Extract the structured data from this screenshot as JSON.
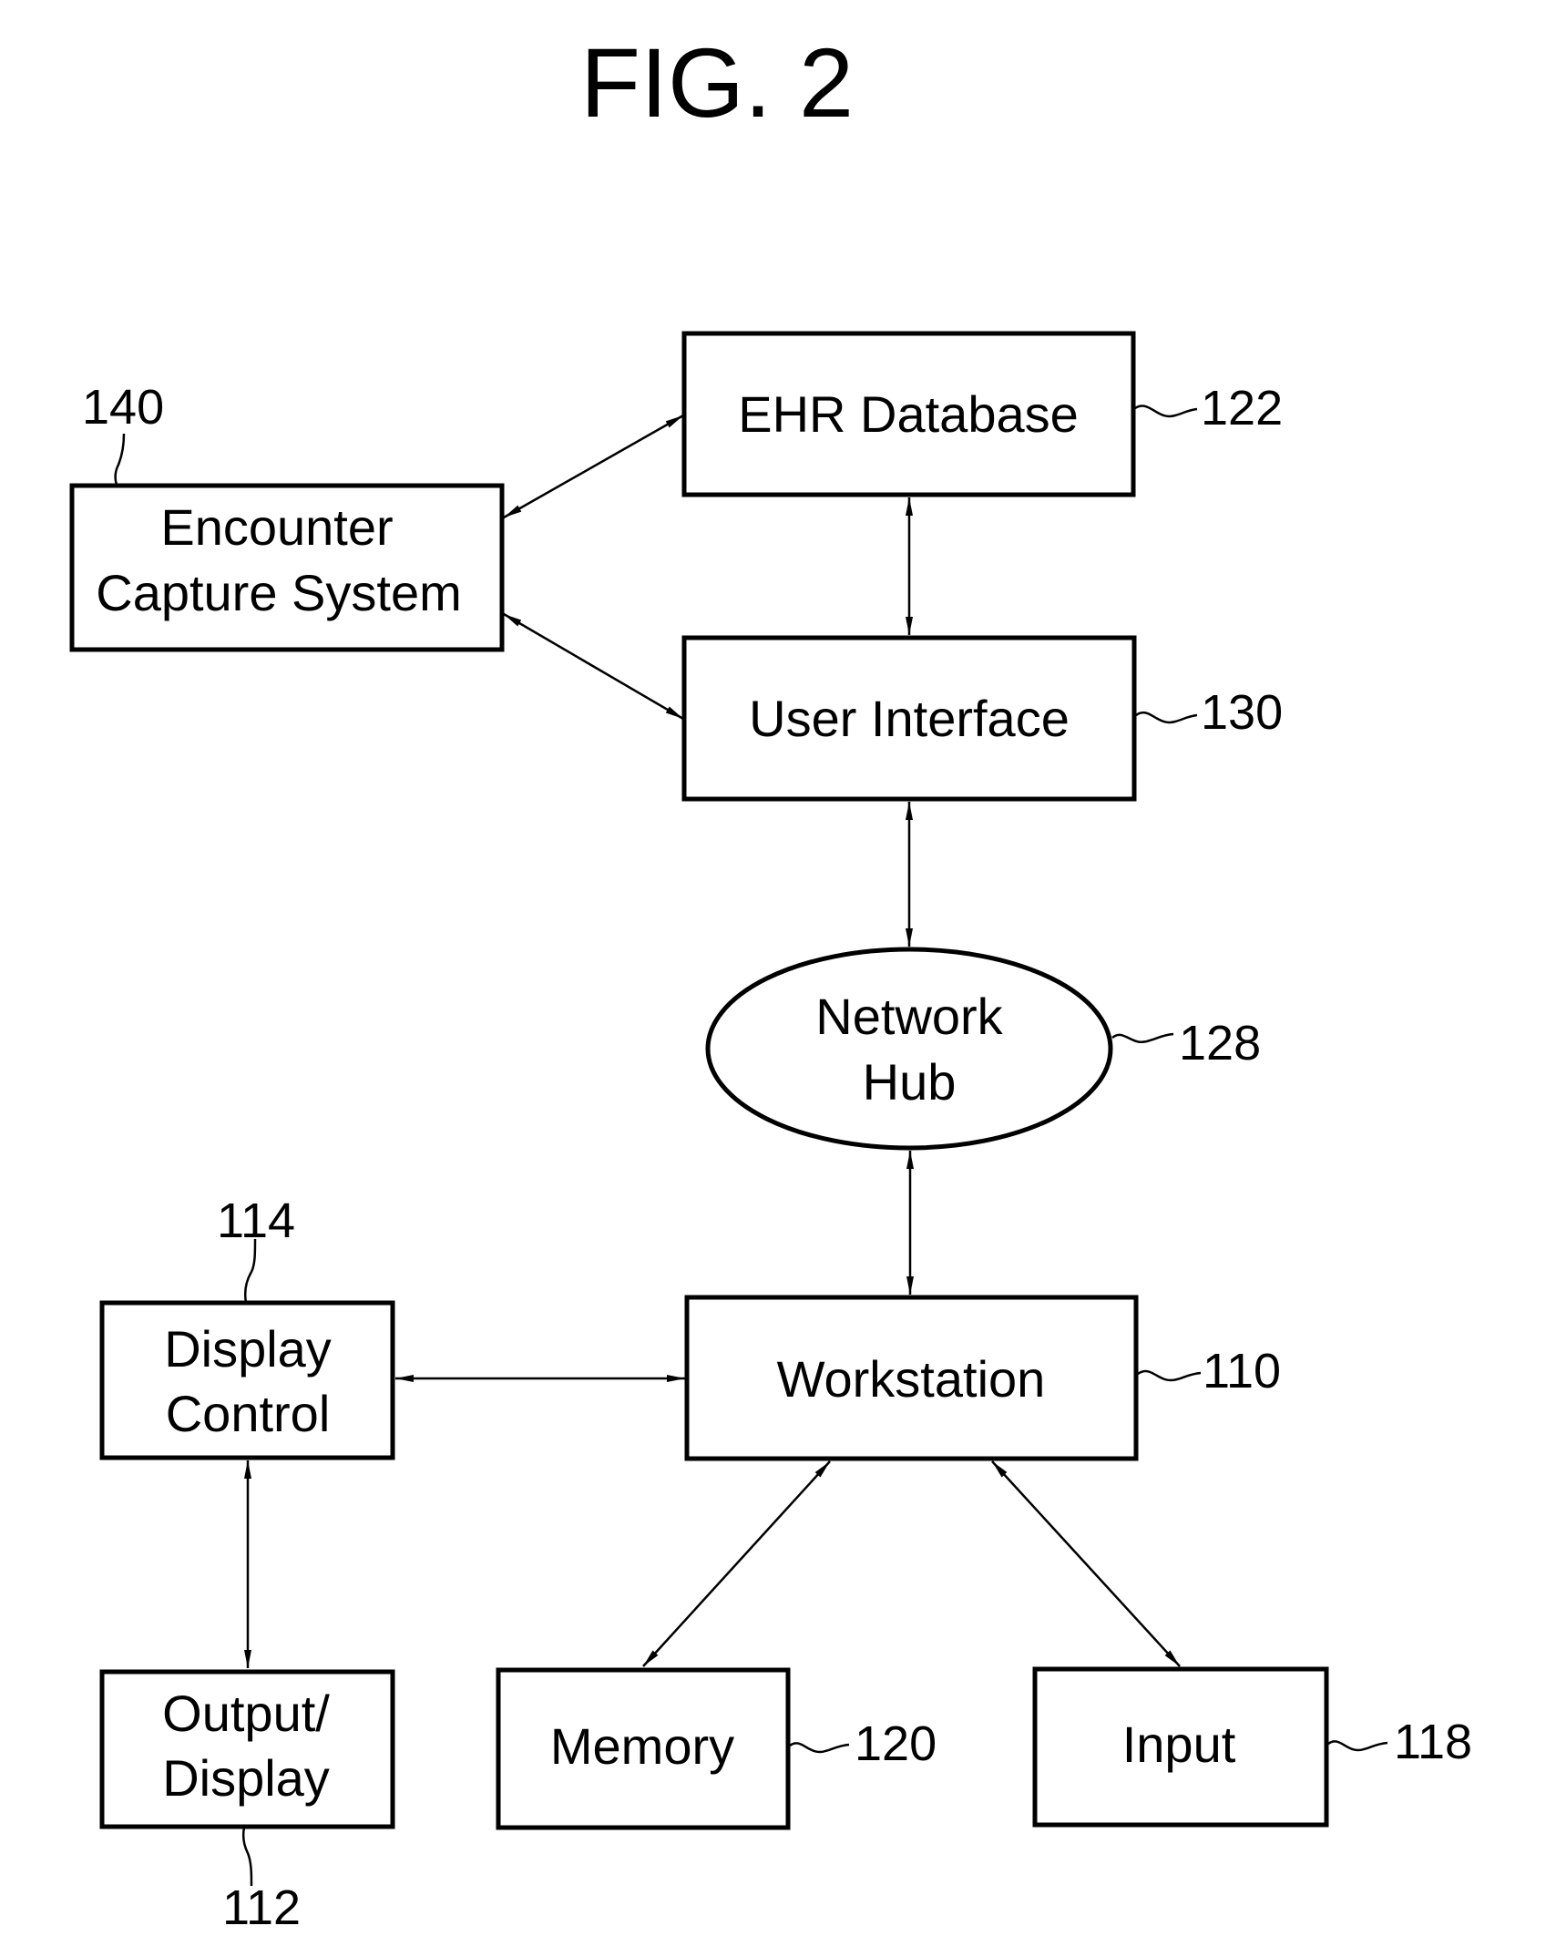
{
  "figure": {
    "title": "FIG. 2"
  },
  "nodes": {
    "ehr_database": {
      "label": [
        "EHR Database"
      ],
      "ref": "122"
    },
    "encounter_capture": {
      "label": [
        "Encounter",
        "Capture System"
      ],
      "ref": "140"
    },
    "user_interface": {
      "label": [
        "User Interface"
      ],
      "ref": "130"
    },
    "network_hub": {
      "label": [
        "Network",
        "Hub"
      ],
      "ref": "128"
    },
    "workstation": {
      "label": [
        "Workstation"
      ],
      "ref": "110"
    },
    "display_control": {
      "label": [
        "Display",
        "Control"
      ],
      "ref": "114"
    },
    "output_display": {
      "label": [
        "Output/",
        "Display"
      ],
      "ref": "112"
    },
    "memory": {
      "label": [
        "Memory"
      ],
      "ref": "120"
    },
    "input": {
      "label": [
        "Input"
      ],
      "ref": "118"
    }
  },
  "edges": [
    {
      "from": "encounter_capture",
      "to": "ehr_database",
      "direction": "bidirectional"
    },
    {
      "from": "encounter_capture",
      "to": "user_interface",
      "direction": "bidirectional"
    },
    {
      "from": "ehr_database",
      "to": "user_interface",
      "direction": "bidirectional"
    },
    {
      "from": "user_interface",
      "to": "network_hub",
      "direction": "bidirectional"
    },
    {
      "from": "network_hub",
      "to": "workstation",
      "direction": "bidirectional"
    },
    {
      "from": "display_control",
      "to": "workstation",
      "direction": "bidirectional"
    },
    {
      "from": "display_control",
      "to": "output_display",
      "direction": "bidirectional"
    },
    {
      "from": "workstation",
      "to": "memory",
      "direction": "bidirectional"
    },
    {
      "from": "workstation",
      "to": "input",
      "direction": "bidirectional"
    }
  ]
}
